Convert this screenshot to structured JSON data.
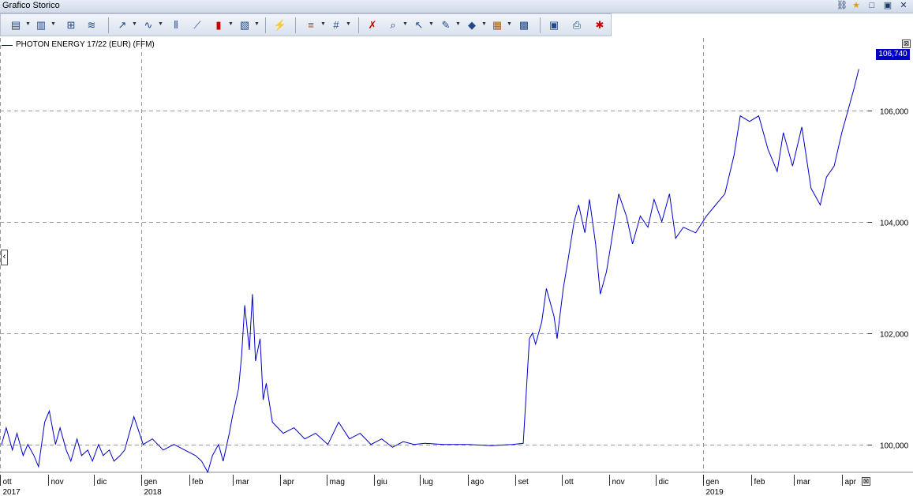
{
  "window": {
    "title": "Grafico Storico"
  },
  "toolbar": {
    "buttons": [
      "chart-type",
      "indicators",
      "compare",
      "overlay",
      "trendline",
      "studies",
      "drawing",
      "candles",
      "colors",
      "auto-scale",
      "line-style",
      "grid",
      "delete",
      "zoom",
      "cursor",
      "pen",
      "fill",
      "notes",
      "export",
      "clipboard",
      "print",
      "properties"
    ]
  },
  "legend": {
    "series_label": "PHOTON ENERGY 17/22 (EUR) (FFM)",
    "close_symbol": "⊠"
  },
  "last_price": {
    "value": "106,740",
    "color": "#0000cc"
  },
  "chart_data": {
    "type": "line",
    "title": "",
    "series": [
      {
        "name": "PHOTON ENERGY 17/22 (EUR) (FFM)",
        "color": "#0000cc",
        "x": [
          "2017-10-02",
          "2017-10-05",
          "2017-10-09",
          "2017-10-12",
          "2017-10-16",
          "2017-10-19",
          "2017-10-23",
          "2017-10-26",
          "2017-10-30",
          "2017-11-02",
          "2017-11-06",
          "2017-11-09",
          "2017-11-13",
          "2017-11-16",
          "2017-11-20",
          "2017-11-23",
          "2017-11-27",
          "2017-11-30",
          "2017-12-04",
          "2017-12-07",
          "2017-12-11",
          "2017-12-14",
          "2017-12-18",
          "2017-12-21",
          "2017-12-27",
          "2018-01-02",
          "2018-01-08",
          "2018-01-15",
          "2018-01-22",
          "2018-01-29",
          "2018-02-05",
          "2018-02-09",
          "2018-02-13",
          "2018-02-16",
          "2018-02-20",
          "2018-02-23",
          "2018-02-27",
          "2018-03-01",
          "2018-03-05",
          "2018-03-07",
          "2018-03-09",
          "2018-03-12",
          "2018-03-14",
          "2018-03-16",
          "2018-03-19",
          "2018-03-21",
          "2018-03-23",
          "2018-03-27",
          "2018-04-03",
          "2018-04-10",
          "2018-04-17",
          "2018-04-24",
          "2018-05-02",
          "2018-05-09",
          "2018-05-16",
          "2018-05-23",
          "2018-05-30",
          "2018-06-06",
          "2018-06-13",
          "2018-06-20",
          "2018-06-27",
          "2018-07-04",
          "2018-07-16",
          "2018-08-01",
          "2018-08-16",
          "2018-08-30",
          "2018-09-06",
          "2018-09-10",
          "2018-09-12",
          "2018-09-14",
          "2018-09-18",
          "2018-09-21",
          "2018-09-26",
          "2018-09-28",
          "2018-10-02",
          "2018-10-05",
          "2018-10-09",
          "2018-10-12",
          "2018-10-16",
          "2018-10-19",
          "2018-10-23",
          "2018-10-26",
          "2018-10-30",
          "2018-11-02",
          "2018-11-07",
          "2018-11-12",
          "2018-11-16",
          "2018-11-21",
          "2018-11-26",
          "2018-11-30",
          "2018-12-05",
          "2018-12-10",
          "2018-12-14",
          "2018-12-19",
          "2018-12-27",
          "2019-01-03",
          "2019-01-09",
          "2019-01-15",
          "2019-01-21",
          "2019-01-25",
          "2019-01-31",
          "2019-02-06",
          "2019-02-12",
          "2019-02-18",
          "2019-02-22",
          "2019-02-28",
          "2019-03-06",
          "2019-03-12",
          "2019-03-18",
          "2019-03-22",
          "2019-03-27",
          "2019-04-01",
          "2019-04-04",
          "2019-04-09",
          "2019-04-12"
        ],
        "y": [
          100.0,
          100.3,
          99.9,
          100.2,
          99.8,
          100.0,
          99.8,
          99.6,
          100.4,
          100.6,
          100.0,
          100.3,
          99.9,
          99.7,
          100.1,
          99.8,
          99.9,
          99.7,
          100.0,
          99.8,
          99.9,
          99.7,
          99.8,
          99.9,
          100.5,
          100.0,
          100.1,
          99.9,
          100.0,
          99.9,
          99.8,
          99.7,
          99.5,
          99.8,
          100.0,
          99.7,
          100.2,
          100.5,
          101.0,
          101.6,
          102.5,
          101.7,
          102.7,
          101.5,
          101.9,
          100.8,
          101.1,
          100.4,
          100.2,
          100.3,
          100.1,
          100.2,
          100.0,
          100.4,
          100.1,
          100.2,
          100.0,
          100.1,
          99.95,
          100.05,
          100.0,
          100.02,
          100.0,
          100.0,
          99.98,
          100.0,
          100.02,
          101.9,
          102.0,
          101.8,
          102.2,
          102.8,
          102.3,
          101.9,
          102.8,
          103.3,
          104.0,
          104.3,
          103.8,
          104.4,
          103.6,
          102.7,
          103.1,
          103.6,
          104.5,
          104.1,
          103.6,
          104.1,
          103.9,
          104.4,
          104.0,
          104.5,
          103.7,
          103.9,
          103.8,
          104.1,
          104.3,
          104.5,
          105.2,
          105.9,
          105.8,
          105.9,
          105.3,
          104.9,
          105.6,
          105.0,
          105.7,
          104.6,
          104.3,
          104.8,
          105.0,
          105.6,
          105.9,
          106.4,
          106.74
        ]
      }
    ],
    "xaxis": {
      "range": [
        "2017-10-02",
        "2019-04-18"
      ],
      "ticks": [
        {
          "label": "ott",
          "date": "2017-10-01",
          "year": "2017"
        },
        {
          "label": "nov",
          "date": "2017-11-01"
        },
        {
          "label": "dic",
          "date": "2017-12-01"
        },
        {
          "label": "gen",
          "date": "2018-01-01",
          "year": "2018"
        },
        {
          "label": "feb",
          "date": "2018-02-01"
        },
        {
          "label": "mar",
          "date": "2018-03-01"
        },
        {
          "label": "apr",
          "date": "2018-04-01"
        },
        {
          "label": "mag",
          "date": "2018-05-01"
        },
        {
          "label": "giu",
          "date": "2018-06-01"
        },
        {
          "label": "lug",
          "date": "2018-07-01"
        },
        {
          "label": "ago",
          "date": "2018-08-01"
        },
        {
          "label": "set",
          "date": "2018-09-01"
        },
        {
          "label": "ott",
          "date": "2018-10-01"
        },
        {
          "label": "nov",
          "date": "2018-11-01"
        },
        {
          "label": "dic",
          "date": "2018-12-01"
        },
        {
          "label": "gen",
          "date": "2019-01-01",
          "year": "2019"
        },
        {
          "label": "feb",
          "date": "2019-02-01"
        },
        {
          "label": "mar",
          "date": "2019-03-01"
        },
        {
          "label": "apr",
          "date": "2019-04-01"
        }
      ]
    },
    "yaxis": {
      "range": [
        99.5,
        107.3
      ],
      "ticks": [
        {
          "value": 100,
          "label": "100,000"
        },
        {
          "value": 102,
          "label": "102,000"
        },
        {
          "value": 104,
          "label": "104,000"
        },
        {
          "value": 106,
          "label": "106,000"
        }
      ],
      "position": "right"
    },
    "grid": true
  }
}
